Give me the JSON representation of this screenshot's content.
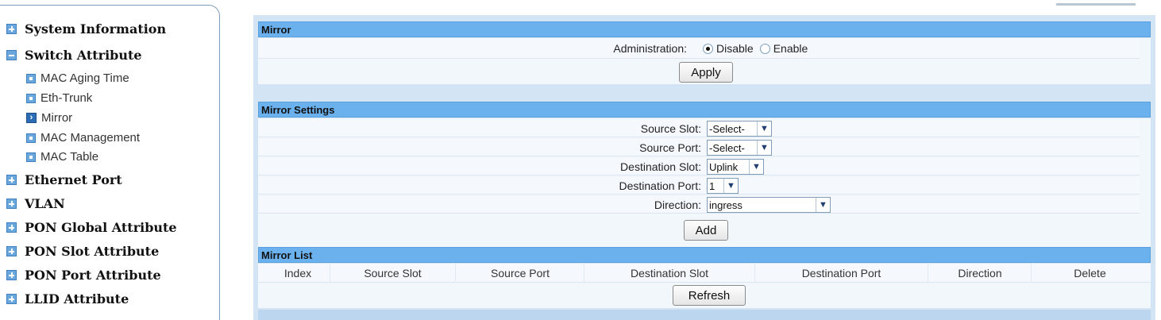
{
  "sidebar": {
    "items": [
      {
        "label": "System Information",
        "type": "folder"
      },
      {
        "label": "Switch Attribute",
        "type": "folder-open"
      },
      {
        "label": "MAC Aging Time",
        "type": "leaf"
      },
      {
        "label": "Eth-Trunk",
        "type": "leaf"
      },
      {
        "label": "Mirror",
        "type": "leaf-active"
      },
      {
        "label": "MAC Management",
        "type": "leaf"
      },
      {
        "label": "MAC Table",
        "type": "leaf"
      },
      {
        "label": "Ethernet Port",
        "type": "folder"
      },
      {
        "label": "VLAN",
        "type": "folder"
      },
      {
        "label": "PON Global Attribute",
        "type": "folder"
      },
      {
        "label": "PON Slot Attribute",
        "type": "folder"
      },
      {
        "label": "PON Port Attribute",
        "type": "folder"
      },
      {
        "label": "LLID Attribute",
        "type": "folder"
      }
    ]
  },
  "mirror": {
    "title": "Mirror",
    "admin_label": "Administration:",
    "disable_label": "Disable",
    "enable_label": "Enable",
    "selected": "Disable",
    "apply_label": "Apply"
  },
  "settings": {
    "title": "Mirror Settings",
    "source_slot_label": "Source Slot:",
    "source_slot_value": "-Select-",
    "source_port_label": "Source Port:",
    "source_port_value": "-Select-",
    "dest_slot_label": "Destination Slot:",
    "dest_slot_value": "Uplink",
    "dest_port_label": "Destination Port:",
    "dest_port_value": "1",
    "direction_label": "Direction:",
    "direction_value": "ingress",
    "add_label": "Add"
  },
  "list": {
    "title": "Mirror List",
    "columns": [
      "Index",
      "Source Slot",
      "Source Port",
      "Destination Slot",
      "Destination Port",
      "Direction",
      "Delete"
    ],
    "refresh_label": "Refresh"
  },
  "icons": {
    "folder": "plus-square-icon",
    "folder_open": "minus-square-icon",
    "leaf": "square-leaf-icon",
    "active": "arrow-right-icon",
    "dropdown": "chevron-down-icon"
  },
  "colors": {
    "header_bg": "#6bb1ee",
    "panel_bg": "#d3e4f5",
    "icon_blue": "#6aa7dc"
  }
}
